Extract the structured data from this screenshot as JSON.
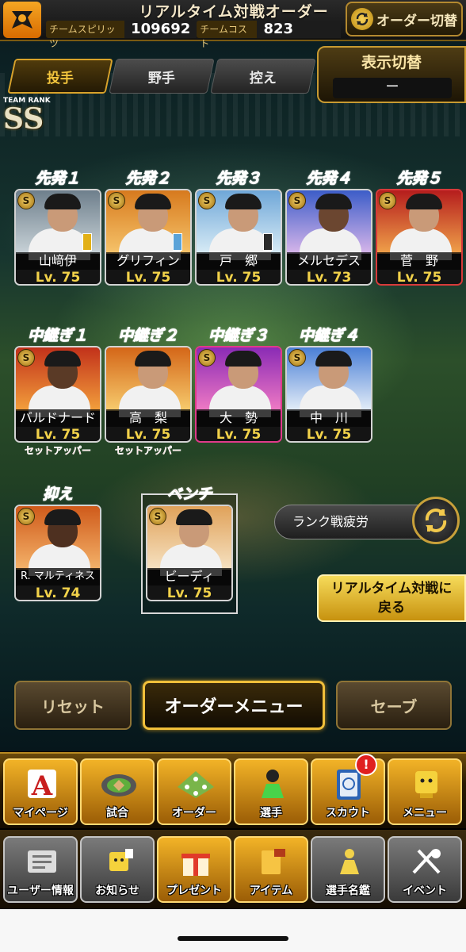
{
  "header": {
    "title": "リアルタイム対戦オーダー",
    "spirit_label": "チームスピリッツ",
    "spirit_value": "109692",
    "cost_label": "チームコスト",
    "cost_value": "823",
    "order_switch": "オーダー切替"
  },
  "tabs": [
    {
      "label": "投手",
      "active": true
    },
    {
      "label": "野手",
      "active": false
    },
    {
      "label": "控え",
      "active": false
    }
  ],
  "display_switch": {
    "title": "表示切替",
    "value": "ー"
  },
  "team_rank": {
    "label": "TEAM RANK",
    "value": "SS"
  },
  "starters": [
    {
      "slot": "先発１",
      "name": "山﨑伊",
      "lv": "Lv. 75"
    },
    {
      "slot": "先発２",
      "name": "グリフィン",
      "lv": "Lv. 75"
    },
    {
      "slot": "先発３",
      "name": "戸　郷",
      "lv": "Lv. 75"
    },
    {
      "slot": "先発４",
      "name": "メルセデス",
      "lv": "Lv. 73"
    },
    {
      "slot": "先発５",
      "name": "菅　野",
      "lv": "Lv. 75"
    }
  ],
  "relievers": [
    {
      "slot": "中継ぎ１",
      "name": "バルドナード",
      "lv": "Lv. 75",
      "role": "セットアッパー"
    },
    {
      "slot": "中継ぎ２",
      "name": "高　梨",
      "lv": "Lv. 75",
      "role": "セットアッパー"
    },
    {
      "slot": "中継ぎ３",
      "name": "大　勢",
      "lv": "Lv. 75",
      "role": ""
    },
    {
      "slot": "中継ぎ４",
      "name": "中　川",
      "lv": "Lv. 75",
      "role": ""
    }
  ],
  "closer": {
    "slot": "抑え",
    "name": "R. マルティネス",
    "lv": "Lv. 74"
  },
  "bench": {
    "slot": "ベンチ",
    "name": "ビーディ",
    "lv": "Lv. 75"
  },
  "fatigue_label": "ランク戦疲労",
  "back_button": {
    "line1": "リアルタイム対戦に",
    "line2": "戻る"
  },
  "actions": {
    "reset": "リセット",
    "menu": "オーダーメニュー",
    "save": "セーブ"
  },
  "nav_primary": [
    {
      "label": "マイページ",
      "icon": "mypage-icon"
    },
    {
      "label": "試合",
      "icon": "stadium-icon"
    },
    {
      "label": "オーダー",
      "icon": "order-icon"
    },
    {
      "label": "選手",
      "icon": "player-icon"
    },
    {
      "label": "スカウト",
      "icon": "scout-icon"
    },
    {
      "label": "メニュー",
      "icon": "menu-icon"
    }
  ],
  "nav_notification": "!",
  "nav_secondary": [
    {
      "label": "ユーザー情報",
      "icon": "user-info-icon"
    },
    {
      "label": "お知らせ",
      "icon": "notice-icon"
    },
    {
      "label": "プレゼント",
      "icon": "present-icon"
    },
    {
      "label": "アイテム",
      "icon": "item-icon"
    },
    {
      "label": "選手名鑑",
      "icon": "player-directory-icon"
    },
    {
      "label": "イベント",
      "icon": "event-icon"
    }
  ],
  "colors": {
    "gold": "#f2b327",
    "slot_red": "#e83030",
    "level_yellow": "#f2d24a"
  }
}
